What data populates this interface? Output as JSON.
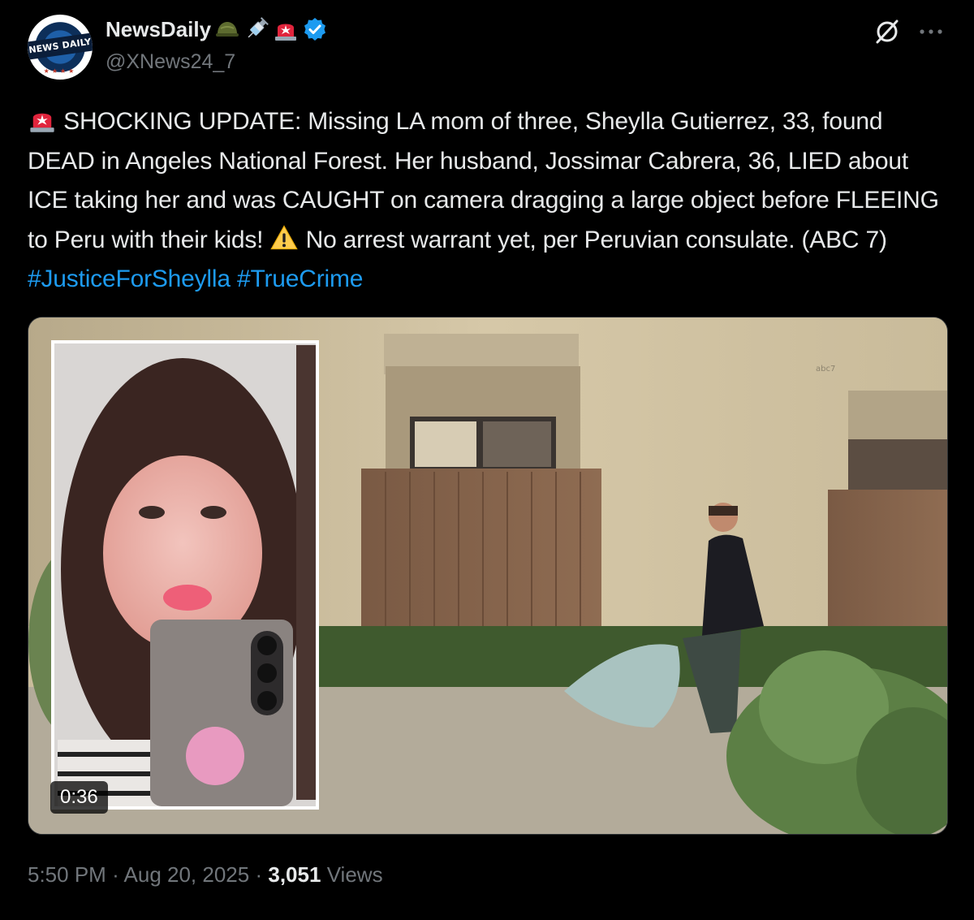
{
  "account": {
    "display_name": "NewsDaily",
    "handle": "@XNews24_7",
    "avatar_text": "NEWS DAILY",
    "verified": true,
    "name_emojis": [
      "military-helmet",
      "syringe",
      "police-light"
    ],
    "verified_color": "#1d9bf0"
  },
  "post": {
    "segments": [
      {
        "type": "emoji",
        "icon": "police-light"
      },
      {
        "type": "text",
        "text": " SHOCKING UPDATE: Missing LA mom of three, Sheylla Gutierrez, 33, found DEAD in Angeles National Forest. Her husband, Jossimar Cabrera, 36, LIED about ICE taking her and was CAUGHT on camera dragging a large object before FLEEING to Peru with their kids! "
      },
      {
        "type": "emoji",
        "icon": "warning-sign"
      },
      {
        "type": "text",
        "text": " No arrest warrant yet, per Peruvian consulate. (ABC 7) "
      },
      {
        "type": "hashtag",
        "text": "#JusticeForSheylla"
      },
      {
        "type": "text",
        "text": " "
      },
      {
        "type": "hashtag",
        "text": "#TrueCrime"
      }
    ]
  },
  "media": {
    "type": "video",
    "duration": "0:36",
    "watermark": "abc7"
  },
  "meta": {
    "time": "5:50 PM",
    "separator": "·",
    "date": "Aug 20, 2025",
    "views_count": "3,051",
    "views_label": "Views"
  },
  "colors": {
    "background": "#000000",
    "text": "#e7e9ea",
    "muted": "#71767b",
    "link": "#1d9bf0"
  }
}
